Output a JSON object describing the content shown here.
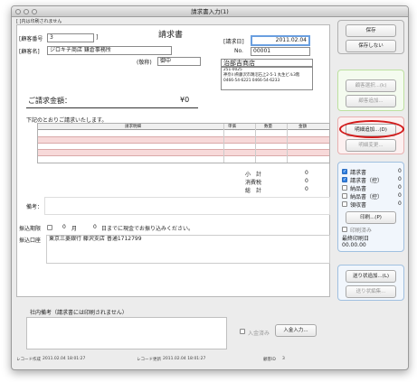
{
  "window": {
    "title": "請求書入力(1)"
  },
  "header": {
    "note": "[ ]内は印刷されません"
  },
  "invoice": {
    "doc_title": "請求書",
    "client_no_label": "[顧客番号",
    "client_no_value": "3",
    "client_no_close": "]",
    "client_name_label": "[顧客名]",
    "client_name_value": "ジロキチ商店 鎌倉事務所",
    "honorific_label": "(敬称)",
    "honorific_value": "御中",
    "date_label": "[請求日]",
    "date_value": "2011.02.04",
    "no_label": "No.",
    "no_value": "00001",
    "company_name": "治部吉商店",
    "company_address": "251-0025\n神奈川県藤沢市鵠沼石上2-5-1 丸生ビル3階\n0466-54-6221  0466-54-6233",
    "amount_label": "ご請求金額：",
    "amount_value": "¥0",
    "intro_text": "下記のとおりご請求いたします。"
  },
  "table": {
    "headers": [
      "請求明細",
      "単価",
      "数量",
      "金額"
    ],
    "rows": 5
  },
  "totals": [
    {
      "label": "小　計",
      "value": "0"
    },
    {
      "label": "消費税",
      "value": "0"
    },
    {
      "label": "総　計",
      "value": "0"
    }
  ],
  "remarks_label": "備考：",
  "deadline": {
    "label": "振込期限",
    "month_value": "0",
    "month_label": "月",
    "day_value": "0",
    "day_text": "日までに現金でお振り込みください。"
  },
  "bank": {
    "label": "振込口座",
    "value": "東京三菱銀行 藤沢支店 普通1712799"
  },
  "internal_note_label": "社内備考（請求書には印刷されません）",
  "payment": {
    "checkbox_label": "入金済み",
    "button_label": "入金入力..."
  },
  "footer": {
    "created_label": "レコード作成",
    "created_value": "2011.02.04 18:01:27",
    "updated_label": "レコード更新",
    "updated_value": "2011.02.04 18:01:27",
    "record_id_label": "顧客ID",
    "record_id_value": "3"
  },
  "side": {
    "save": "保存",
    "nosave": "保存しない",
    "customer_select": "顧客選択...(k)",
    "customer_add": "顧客追加...",
    "detail_add": "明細追加...(D)",
    "detail_change": "明細変更...",
    "print_items": [
      {
        "label": "請求書",
        "count": "0",
        "checked": true
      },
      {
        "label": "請求書（控）",
        "count": "0",
        "checked": true
      },
      {
        "label": "納品書",
        "count": "0",
        "checked": false
      },
      {
        "label": "納品書（控）",
        "count": "0",
        "checked": false
      },
      {
        "label": "領収書",
        "count": "0",
        "checked": false
      }
    ],
    "print_button": "印刷...(P)",
    "printed_label": "印刷済み",
    "last_print_label": "最終印刷日",
    "last_print_value": "00.00.00",
    "ship_add": "送り状追加...(L)",
    "ship_edit": "送り状編集..."
  },
  "colors": {
    "accent": "#2f7fe0",
    "highlight": "#d21a1a",
    "row_pink": "#f7d9d9"
  }
}
